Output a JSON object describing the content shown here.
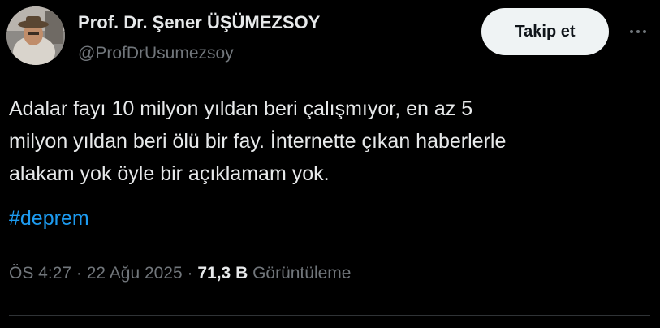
{
  "author": {
    "display_name": "Prof. Dr. Şener ÜŞÜMEZSOY",
    "handle": "@ProfDrUsumezsoy"
  },
  "follow_button": {
    "label": "Takip et"
  },
  "more_button": {
    "icon": "more-horizontal-icon"
  },
  "tweet": {
    "lines": [
      "Adalar fayı 10 milyon yıldan beri çalışmıyor, en az 5",
      "milyon yıldan beri ölü bir fay. İnternette çıkan haberlerle",
      "alakam yok öyle bir açıklamam yok."
    ],
    "hashtag": "#deprem"
  },
  "meta": {
    "time": "ÖS 4:27",
    "separator1": " · ",
    "date": "22 Ağu 2025",
    "separator2": " · ",
    "views_count": "71,3 B",
    "views_label": " Görüntüleme"
  },
  "colors": {
    "background": "#000000",
    "text": "#e7e9ea",
    "secondary_text": "#71767b",
    "link": "#1d9bf0",
    "button_bg": "#eff3f4"
  }
}
